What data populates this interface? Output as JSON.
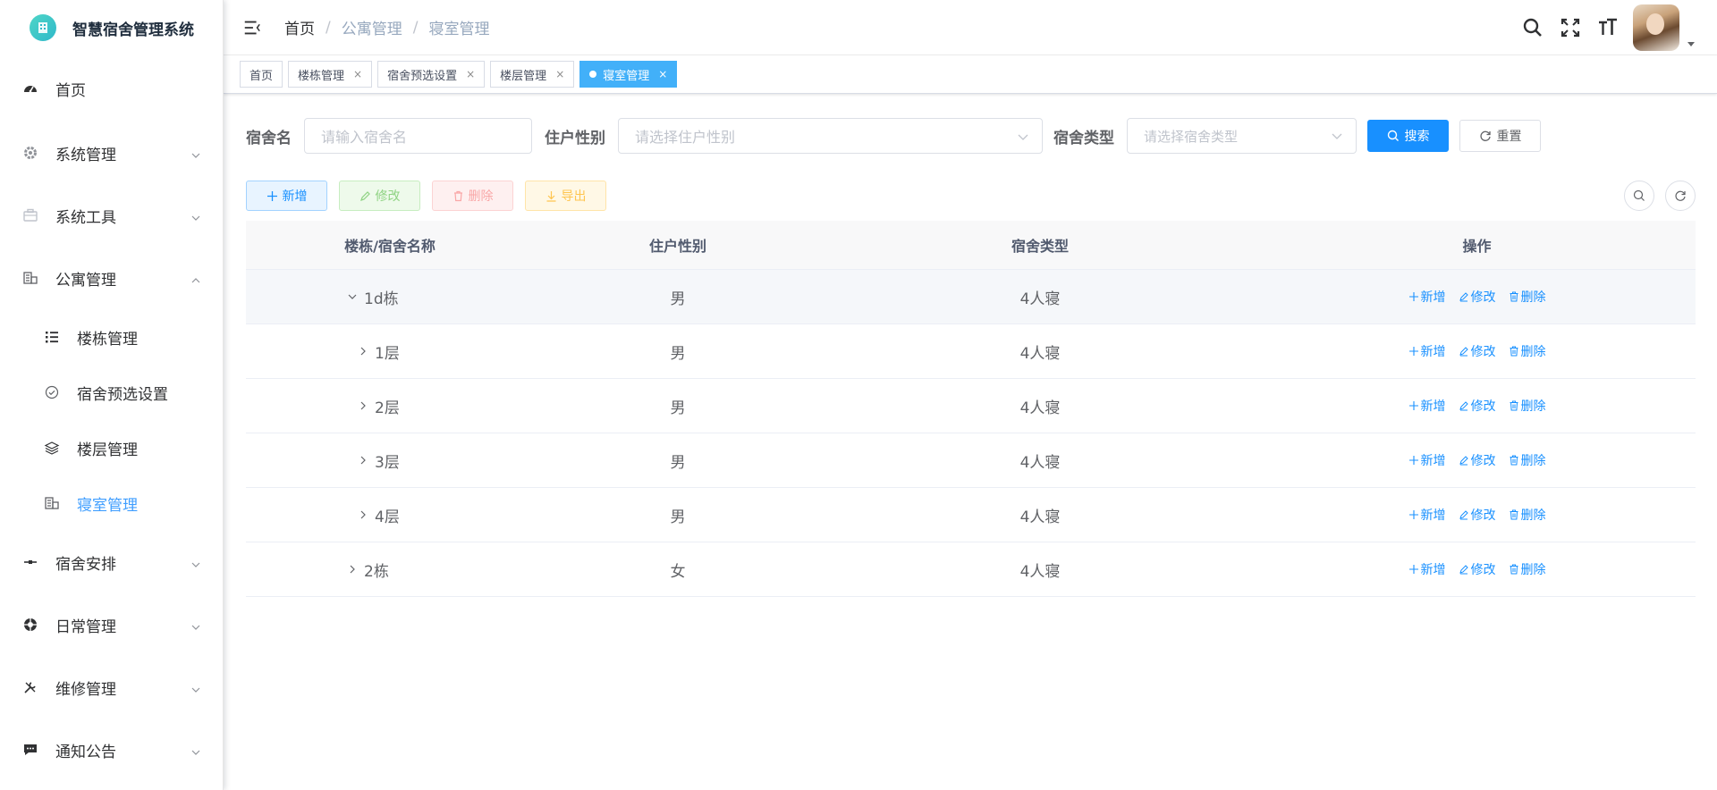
{
  "app": {
    "title": "智慧宿舍管理系统"
  },
  "sidebar": {
    "items": [
      {
        "label": "首页",
        "icon": "dashboard-icon"
      },
      {
        "label": "系统管理",
        "icon": "gear-icon"
      },
      {
        "label": "系统工具",
        "icon": "toolbox-icon"
      },
      {
        "label": "公寓管理",
        "icon": "building-icon",
        "expanded": true
      },
      {
        "label": "宿舍安排",
        "icon": "arrange-icon"
      },
      {
        "label": "日常管理",
        "icon": "lifebuoy-icon"
      },
      {
        "label": "维修管理",
        "icon": "wrench-icon"
      },
      {
        "label": "通知公告",
        "icon": "message-icon"
      }
    ],
    "submenu": [
      {
        "label": "楼栋管理",
        "icon": "list-icon"
      },
      {
        "label": "宿舍预选设置",
        "icon": "check-circle-icon"
      },
      {
        "label": "楼层管理",
        "icon": "layers-icon"
      },
      {
        "label": "寝室管理",
        "icon": "building-icon",
        "active": true
      }
    ]
  },
  "navbar": {
    "breadcrumb": [
      "首页",
      "公寓管理",
      "寝室管理"
    ],
    "separator": "/"
  },
  "tags": [
    {
      "label": "首页",
      "closable": false
    },
    {
      "label": "楼栋管理",
      "closable": true
    },
    {
      "label": "宿舍预选设置",
      "closable": true
    },
    {
      "label": "楼层管理",
      "closable": true
    },
    {
      "label": "寝室管理",
      "closable": true,
      "active": true
    }
  ],
  "tag_close": "×",
  "search": {
    "name_label": "宿舍名",
    "name_placeholder": "请输入宿舍名",
    "gender_label": "住户性别",
    "gender_placeholder": "请选择住户性别",
    "type_label": "宿舍类型",
    "type_placeholder": "请选择宿舍类型",
    "search_button": "搜索",
    "reset_button": "重置"
  },
  "toolbar": {
    "add": "新增",
    "edit": "修改",
    "delete": "删除",
    "export": "导出"
  },
  "table": {
    "headers": [
      "楼栋/宿舍名称",
      "住户性别",
      "宿舍类型",
      "操作"
    ],
    "rows": [
      {
        "name": "1d栋",
        "gender": "男",
        "type": "4人寝",
        "expanded": true,
        "level": 0
      },
      {
        "name": "1层",
        "gender": "男",
        "type": "4人寝",
        "expanded": false,
        "level": 1
      },
      {
        "name": "2层",
        "gender": "男",
        "type": "4人寝",
        "expanded": false,
        "level": 1
      },
      {
        "name": "3层",
        "gender": "男",
        "type": "4人寝",
        "expanded": false,
        "level": 1
      },
      {
        "name": "4层",
        "gender": "男",
        "type": "4人寝",
        "expanded": false,
        "level": 1
      },
      {
        "name": "2栋",
        "gender": "女",
        "type": "4人寝",
        "expanded": false,
        "level": 0
      }
    ],
    "ops": [
      "新增",
      "修改",
      "删除"
    ]
  },
  "colors": {
    "primary": "#1890ff",
    "active_tag": "#42b0f9",
    "sidebar_active": "#409eff"
  }
}
